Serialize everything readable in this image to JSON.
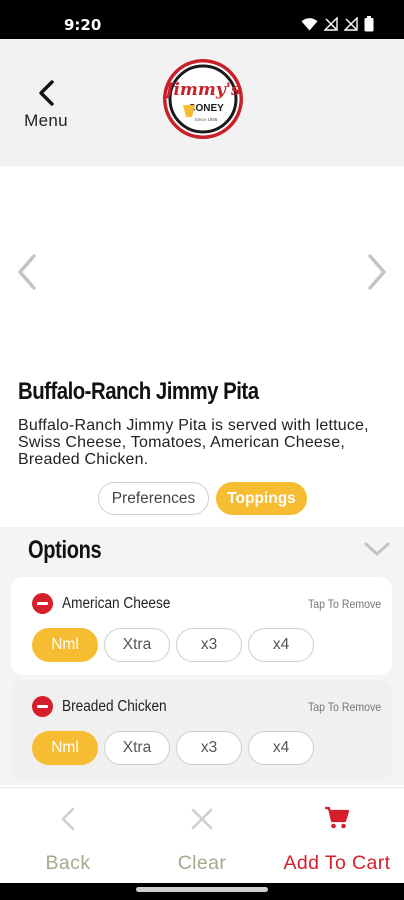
{
  "status_bar": {
    "time": "9:20"
  },
  "header": {
    "back_label": "Menu",
    "logo_text_main": "Jimmy's",
    "logo_text_sub": "CONEY",
    "logo_text_est": "Since 1988"
  },
  "item": {
    "title": "Buffalo-Ranch Jimmy Pita",
    "description": "Buffalo-Ranch Jimmy Pita is served with lettuce, Swiss Cheese, Tomatoes, American Cheese, Breaded Chicken."
  },
  "tabs": [
    {
      "label": "Preferences",
      "active": false
    },
    {
      "label": "Toppings",
      "active": true
    }
  ],
  "options": {
    "title": "Options",
    "items": [
      {
        "name": "American Cheese",
        "action": "Tap To Remove",
        "quantities": [
          "Nml",
          "Xtra",
          "x3",
          "x4"
        ],
        "selected": "Nml"
      },
      {
        "name": "Breaded Chicken",
        "action": "Tap To Remove",
        "quantities": [
          "Nml",
          "Xtra",
          "x3",
          "x4"
        ],
        "selected": "Nml"
      }
    ]
  },
  "bottom_nav": {
    "back_label": "Back",
    "clear_label": "Clear",
    "cart_label": "Add To Cart"
  },
  "colors": {
    "accent": "#f6bd32",
    "brand_red": "#d51f2b",
    "muted": "#a7a98e"
  },
  "icons": {
    "status": [
      "wifi-icon",
      "signal-off-icon",
      "signal-off-icon",
      "battery-icon"
    ],
    "header": [
      "chevron-left-icon"
    ],
    "carousel": [
      "chevron-left-icon",
      "chevron-right-icon"
    ],
    "options": [
      "chevron-down-icon",
      "remove-icon"
    ],
    "bottom_nav": [
      "chevron-left-icon",
      "close-icon",
      "cart-icon"
    ]
  }
}
